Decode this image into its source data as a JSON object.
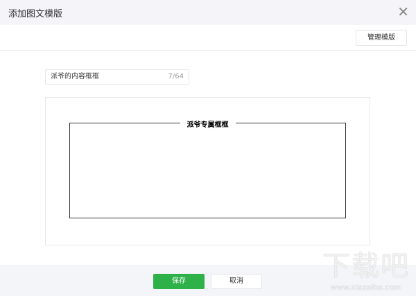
{
  "dialog": {
    "title": "添加图文模版",
    "close_icon": "close-icon"
  },
  "toolbar": {
    "manage_label": "管理模版"
  },
  "title_input": {
    "value": "派爷的内容框框",
    "counter": "7/64"
  },
  "preview": {
    "frame_title": "派爷专属框框"
  },
  "footer": {
    "save_label": "保存",
    "cancel_label": "取消"
  },
  "watermark": {
    "logo": "下载吧",
    "url": "www.xiazaiba.com"
  }
}
